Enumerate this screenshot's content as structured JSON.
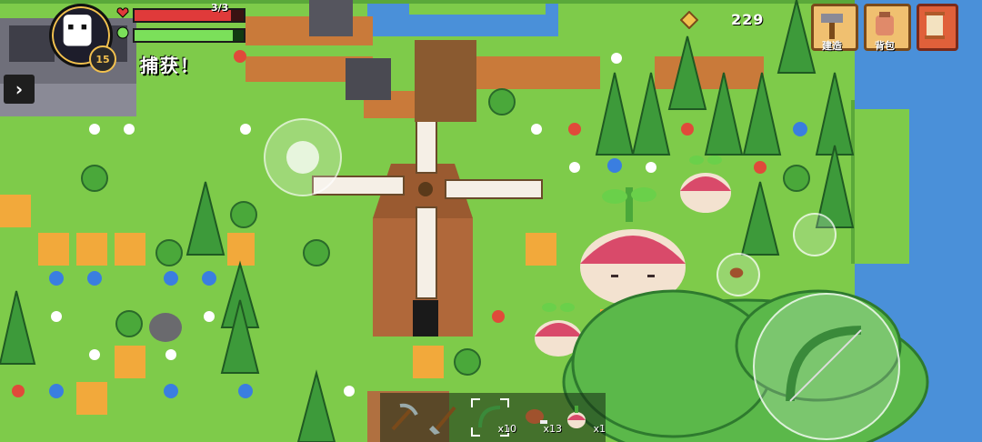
{
  "hud": {
    "level": "15",
    "hp_text": "3/3",
    "hp_fraction": 0.88,
    "energy_fraction": 0.9,
    "notice": "捕获！",
    "coins": "229"
  },
  "menu": {
    "build_label": "建造",
    "bag_label": "背包"
  },
  "hotbar": {
    "slots": [
      {
        "icon": "pickaxe-icon",
        "count": ""
      },
      {
        "icon": "shovel-icon",
        "count": ""
      },
      {
        "icon": "bow-icon",
        "count": "x10",
        "selected": true
      },
      {
        "icon": "meat-icon",
        "count": "x13"
      },
      {
        "icon": "turnip-icon",
        "count": "x1"
      }
    ]
  },
  "colors": {
    "grass": "#7ecb4a",
    "water": "#4a90d9",
    "hp": "#e03a3a",
    "energy": "#7be05a",
    "accent": "#f2c14e"
  }
}
